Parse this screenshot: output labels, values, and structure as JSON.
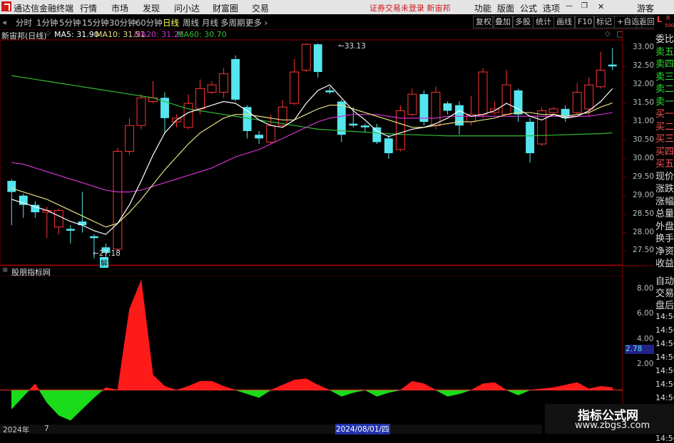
{
  "app": {
    "name": "通达信金融终端",
    "notice": "证券交易未登录",
    "stock_name": "新宙邦"
  },
  "menu": [
    "行情",
    "市场",
    "发现",
    "问小达",
    "财富圈",
    "交易"
  ],
  "right_menu": [
    "功能",
    "版面",
    "公式",
    "选项",
    "游客"
  ],
  "periods": [
    "分时",
    "1分钟",
    "5分钟",
    "15分钟",
    "30分钟",
    "60分钟",
    "日线",
    "周线",
    "月线",
    "多周期",
    "更多"
  ],
  "active_period": "日线",
  "toolbar": [
    "复权",
    "叠加",
    "多股",
    "统计",
    "画线",
    "F10",
    "标记",
    "+自选",
    "返回"
  ],
  "side_badge": {
    "letter": "L",
    "sub": "R",
    "num": "500"
  },
  "header": {
    "title": "新宙邦(日线)",
    "ma5": "MA5: 31.90",
    "ma10": "MA10: 31.51",
    "ma20": "MA20: 31.25",
    "ma60": "MA60: 30.70"
  },
  "colors": {
    "up": "#ff3333",
    "down": "#55e5ee",
    "ma5": "#ffffff",
    "ma10": "#e8e080",
    "ma20": "#cc33cc",
    "ma60": "#33bb33",
    "accent": "#d21818"
  },
  "y_axis_price": [
    "33.00",
    "32.50",
    "32.00",
    "31.50",
    "31.00",
    "30.50",
    "30.00",
    "29.50",
    "29.00",
    "28.50",
    "28.00",
    "27.50"
  ],
  "annotations": {
    "high": "33.13",
    "low": "27.18",
    "tag": "解"
  },
  "indicator": {
    "title": "股朋指标网",
    "y_axis": [
      "8.00",
      "6.00",
      "4.00",
      "2.00"
    ],
    "current_value": "2.78"
  },
  "side_labels_top": [
    "委比",
    "卖五",
    "卖四",
    "卖三",
    "卖二",
    "卖一",
    "买一",
    "买二",
    "买三",
    "买四",
    "买五",
    "现价",
    "涨跌",
    "涨幅",
    "总量",
    "外盘",
    "换手",
    "净资",
    "收益"
  ],
  "side_labels_bottom": [
    "自动",
    "交易",
    "盘后"
  ],
  "side_times": [
    "14:56",
    "14:56",
    "14:56",
    "14:56",
    "14:56",
    "14:56",
    "14:56",
    "14:56",
    "14:56",
    "14:56"
  ],
  "bottom_bar": {
    "year": "2024年",
    "month": "7",
    "date": "2024/08/01/四"
  },
  "watermark": {
    "title": "指标公式网",
    "url": "www.zbgs3.com"
  },
  "chart_data": {
    "type": "candlestick",
    "y_range": [
      27.2,
      33.2
    ],
    "candles": [
      [
        29.4,
        29.1,
        29.45,
        28.2
      ],
      [
        29.0,
        28.75,
        29.05,
        28.4
      ],
      [
        28.75,
        28.55,
        28.85,
        28.4
      ],
      [
        28.55,
        28.6,
        28.7,
        27.85
      ],
      [
        28.15,
        28.6,
        28.65,
        27.95
      ],
      [
        28.1,
        28.05,
        28.2,
        27.7
      ],
      [
        28.3,
        28.2,
        29.1,
        28.0
      ],
      [
        27.9,
        27.85,
        27.95,
        27.3
      ],
      [
        27.6,
        27.45,
        27.7,
        27.25
      ],
      [
        27.55,
        30.2,
        30.3,
        27.5
      ],
      [
        30.2,
        30.9,
        31.1,
        30.1
      ],
      [
        30.9,
        31.65,
        31.75,
        30.8
      ],
      [
        31.55,
        31.65,
        32.1,
        31.5
      ],
      [
        31.65,
        31.1,
        31.8,
        30.7
      ],
      [
        31.0,
        31.1,
        31.2,
        30.85
      ],
      [
        30.85,
        31.5,
        31.75,
        30.8
      ],
      [
        31.35,
        31.9,
        32.15,
        31.2
      ],
      [
        31.8,
        32.0,
        32.1,
        31.75
      ],
      [
        31.8,
        32.3,
        32.45,
        31.65
      ],
      [
        32.7,
        31.6,
        32.8,
        31.55
      ],
      [
        31.4,
        30.75,
        31.45,
        30.55
      ],
      [
        30.65,
        30.55,
        30.75,
        30.4
      ],
      [
        30.45,
        30.9,
        31.2,
        30.4
      ],
      [
        30.9,
        31.4,
        31.6,
        30.85
      ],
      [
        31.5,
        32.35,
        32.7,
        31.45
      ],
      [
        32.4,
        33.1,
        33.13,
        32.35
      ],
      [
        33.1,
        32.35,
        33.13,
        32.2
      ],
      [
        31.85,
        31.8,
        31.95,
        31.75
      ],
      [
        31.55,
        30.65,
        31.6,
        30.45
      ],
      [
        30.95,
        30.9,
        31.4,
        30.85
      ],
      [
        30.9,
        30.85,
        30.95,
        30.7
      ],
      [
        30.85,
        30.45,
        30.95,
        30.4
      ],
      [
        30.55,
        30.15,
        30.65,
        30.0
      ],
      [
        30.25,
        31.3,
        31.45,
        30.2
      ],
      [
        31.2,
        31.75,
        31.9,
        31.15
      ],
      [
        31.75,
        31.0,
        31.85,
        30.9
      ],
      [
        30.9,
        31.8,
        31.95,
        30.8
      ],
      [
        31.5,
        31.3,
        31.55,
        31.2
      ],
      [
        31.45,
        30.9,
        31.55,
        30.65
      ],
      [
        31.0,
        31.2,
        31.7,
        30.9
      ],
      [
        31.2,
        32.35,
        32.45,
        31.1
      ],
      [
        31.25,
        31.35,
        31.55,
        31.2
      ],
      [
        31.2,
        32.0,
        32.4,
        31.2
      ],
      [
        31.85,
        31.2,
        31.9,
        31.0
      ],
      [
        31.0,
        30.15,
        31.1,
        29.9
      ],
      [
        30.4,
        31.3,
        31.4,
        30.35
      ],
      [
        31.25,
        31.35,
        31.4,
        31.15
      ],
      [
        31.35,
        31.1,
        31.45,
        31.0
      ],
      [
        31.25,
        31.8,
        32.05,
        31.2
      ],
      [
        31.35,
        32.0,
        32.2,
        31.15
      ],
      [
        31.95,
        32.4,
        32.9,
        31.9
      ],
      [
        32.55,
        32.5,
        33.0,
        32.4
      ]
    ],
    "ma5": [
      28.9,
      28.8,
      28.7,
      28.6,
      28.45,
      28.3,
      28.2,
      28.05,
      27.95,
      28.25,
      28.75,
      29.4,
      30.1,
      30.7,
      31.05,
      31.25,
      31.35,
      31.45,
      31.55,
      31.5,
      31.3,
      31.05,
      30.9,
      30.85,
      31.05,
      31.5,
      31.85,
      32.0,
      31.65,
      31.3,
      31.05,
      30.75,
      30.6,
      30.7,
      30.8,
      30.85,
      30.95,
      31.1,
      31.3,
      31.15,
      31.2,
      31.3,
      31.5,
      31.35,
      31.15,
      31.05,
      31.2,
      31.1,
      31.15,
      31.3,
      31.55,
      31.9
    ],
    "ma10": [
      29.2,
      29.1,
      29.0,
      28.9,
      28.75,
      28.6,
      28.45,
      28.3,
      28.15,
      28.25,
      28.55,
      28.9,
      29.3,
      29.7,
      30.05,
      30.4,
      30.7,
      30.9,
      31.1,
      31.2,
      31.2,
      31.15,
      31.1,
      31.05,
      31.05,
      31.2,
      31.35,
      31.45,
      31.45,
      31.35,
      31.25,
      31.15,
      31.05,
      30.95,
      30.85,
      30.85,
      30.9,
      30.95,
      31.0,
      31.0,
      31.05,
      31.1,
      31.2,
      31.25,
      31.25,
      31.2,
      31.2,
      31.15,
      31.2,
      31.25,
      31.4,
      31.51
    ],
    "ma20": [
      29.9,
      29.85,
      29.75,
      29.65,
      29.55,
      29.45,
      29.35,
      29.25,
      29.15,
      29.1,
      29.1,
      29.15,
      29.25,
      29.35,
      29.45,
      29.55,
      29.65,
      29.75,
      29.9,
      30.05,
      30.15,
      30.25,
      30.4,
      30.55,
      30.7,
      30.85,
      31.0,
      31.1,
      31.15,
      31.2,
      31.2,
      31.2,
      31.15,
      31.1,
      31.1,
      31.1,
      31.1,
      31.15,
      31.15,
      31.15,
      31.15,
      31.15,
      31.15,
      31.15,
      31.15,
      31.15,
      31.15,
      31.15,
      31.15,
      31.15,
      31.2,
      31.25
    ],
    "ma60": [
      32.25,
      32.2,
      32.15,
      32.1,
      32.05,
      32.0,
      31.95,
      31.9,
      31.85,
      31.8,
      31.75,
      31.7,
      31.65,
      31.55,
      31.45,
      31.35,
      31.3,
      31.25,
      31.2,
      31.15,
      31.1,
      31.05,
      31.0,
      30.95,
      30.9,
      30.85,
      30.8,
      30.78,
      30.76,
      30.74,
      30.72,
      30.7,
      30.68,
      30.66,
      30.65,
      30.64,
      30.63,
      30.62,
      30.62,
      30.62,
      30.62,
      30.62,
      30.62,
      30.62,
      30.62,
      30.63,
      30.64,
      30.65,
      30.66,
      30.67,
      30.68,
      30.7
    ],
    "indicator_y_range": [
      -2.5,
      9.0
    ],
    "indicator": [
      -1.5,
      -0.5,
      0.5,
      -1.0,
      -2.0,
      -2.4,
      -1.5,
      -0.6,
      0.2,
      0.0,
      6.4,
      8.7,
      1.2,
      0.3,
      0.0,
      0.3,
      0.7,
      0.7,
      0.3,
      0.0,
      -0.3,
      -0.6,
      0.0,
      0.4,
      0.8,
      0.9,
      0.4,
      0.0,
      -0.5,
      -0.2,
      0.0,
      -0.5,
      -0.2,
      0.0,
      0.7,
      0.5,
      0.0,
      -0.5,
      -0.3,
      0.0,
      0.5,
      0.6,
      0.0,
      -0.4,
      0.0,
      0.1,
      0.2,
      0.4,
      0.6,
      0.1,
      0.3,
      0.2
    ]
  }
}
